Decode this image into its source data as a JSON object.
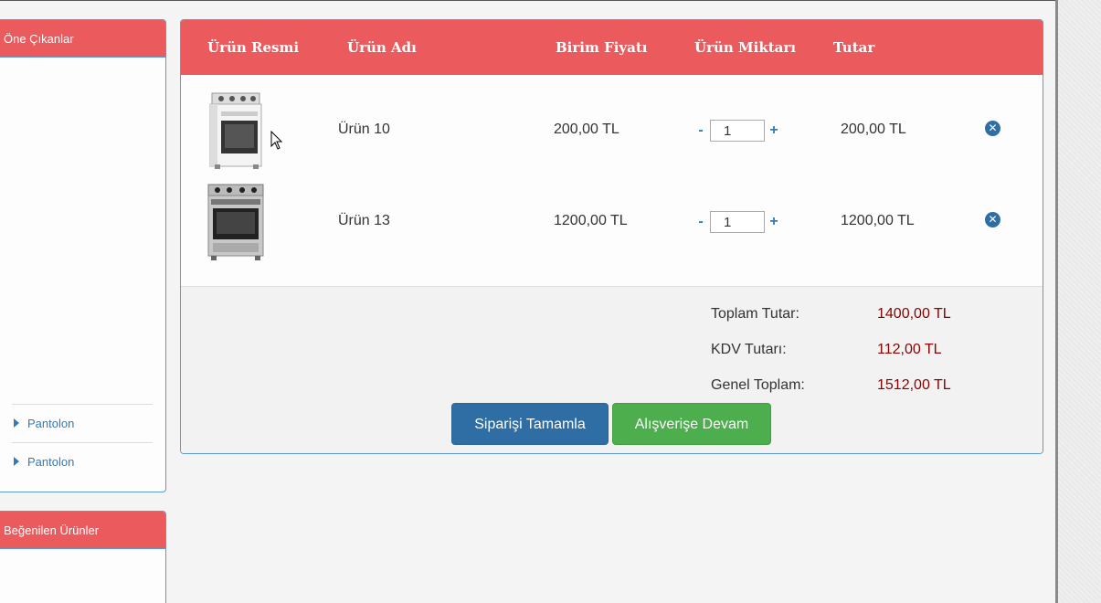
{
  "sidebar": {
    "featured_title": "Öne Çıkanlar",
    "items": [
      {
        "label": "Pantolon"
      },
      {
        "label": "Pantolon"
      }
    ],
    "liked_title": "Beğenilen Ürünler"
  },
  "cart": {
    "columns": {
      "image": "Ürün Resmi",
      "name": "Ürün Adı",
      "unit_price": "Birim Fiyatı",
      "quantity": "Ürün Miktarı",
      "total": "Tutar"
    },
    "rows": [
      {
        "name": "Ürün 10",
        "unit_price": "200,00 TL",
        "quantity": "1",
        "total": "200,00 TL",
        "image_icon": "gas-stove-white-icon"
      },
      {
        "name": "Ürün 13",
        "unit_price": "1200,00 TL",
        "quantity": "1",
        "total": "1200,00 TL",
        "image_icon": "gas-stove-steel-icon"
      }
    ],
    "minus_label": "-",
    "plus_label": "+",
    "summary": {
      "subtotal_label": "Toplam Tutar:",
      "subtotal_value": "1400,00 TL",
      "vat_label": "KDV Tutarı:",
      "vat_value": "112,00 TL",
      "grand_total_label": "Genel Toplam:",
      "grand_total_value": "1512,00 TL"
    },
    "buttons": {
      "complete_order": "Siparişi Tamamla",
      "continue_shopping": "Alışverişe Devam"
    }
  },
  "colors": {
    "header_red": "#eb5b5e",
    "link_blue": "#337ab7",
    "button_blue": "#2f6ea5",
    "button_green": "#4cae4c",
    "price_red": "#8b0000"
  }
}
